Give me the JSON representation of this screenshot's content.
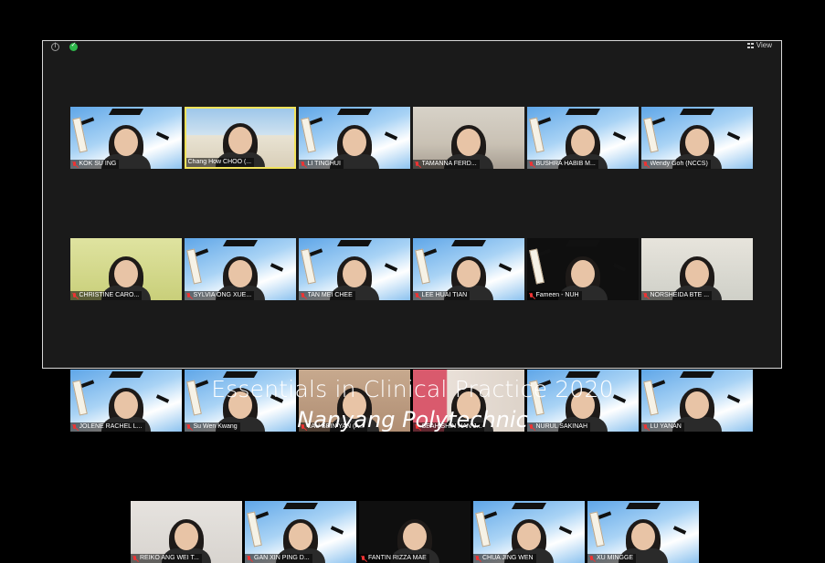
{
  "window": {
    "view_label": "View",
    "icons": {
      "info": "info-icon",
      "security": "shield-check-icon",
      "view": "grid-view-icon"
    }
  },
  "participants": [
    {
      "name": "KOK SU ING",
      "background": "graduation",
      "muted": true
    },
    {
      "name": "Chang How CHOO (...",
      "background": "building",
      "muted": false,
      "active_speaker": true
    },
    {
      "name": "LI TINGHUI",
      "background": "graduation",
      "muted": true
    },
    {
      "name": "TAMANNA FERD...",
      "background": "room",
      "muted": true
    },
    {
      "name": "BUSHRA HABIB M...",
      "background": "graduation",
      "muted": true
    },
    {
      "name": "Wendy Goh (NCCS)",
      "background": "graduation",
      "muted": true
    },
    {
      "name": "CHRISTINE CARO...",
      "background": "green-wall",
      "muted": true
    },
    {
      "name": "SYLVIA ONG XUE...",
      "background": "graduation",
      "muted": true
    },
    {
      "name": "TAN MEI CHEE",
      "background": "graduation",
      "muted": true
    },
    {
      "name": "LEE HUAI TIAN",
      "background": "graduation",
      "muted": true
    },
    {
      "name": "Fameen - NUH",
      "background": "graduation-dark",
      "muted": true
    },
    {
      "name": "NORSHEIDA BTE ...",
      "background": "office",
      "muted": true
    },
    {
      "name": "JOLENE RACHEL L...",
      "background": "graduation",
      "muted": true
    },
    {
      "name": "Su Wen Kwang",
      "background": "graduation",
      "muted": true
    },
    {
      "name": "LAU SEIN YAN (A...",
      "background": "warm-room",
      "muted": true
    },
    {
      "name": "SEAH SHIN HAN J...",
      "background": "pink-room",
      "muted": true
    },
    {
      "name": "NURUL SAKINAH",
      "background": "graduation",
      "muted": true
    },
    {
      "name": "LU YANAN",
      "background": "graduation",
      "muted": true
    },
    {
      "name": "REIKO ANG WEI T...",
      "background": "shelf",
      "muted": true
    },
    {
      "name": "GAN XIN PING D...",
      "background": "graduation",
      "muted": true
    },
    {
      "name": "FANTIN RIZZA MAE",
      "background": "dark-room",
      "muted": true
    },
    {
      "name": "CHUA JING WEN",
      "background": "graduation",
      "muted": true
    },
    {
      "name": "XU MINGGE",
      "background": "graduation",
      "muted": true
    }
  ],
  "caption": {
    "title": "Essentials in Clinical Practice 2020",
    "subtitle": "Nanyang Polytechnic"
  },
  "colors": {
    "active_speaker_border": "#f2e35a",
    "muted_mic": "#e33333",
    "secure_badge": "#2eb84b"
  }
}
